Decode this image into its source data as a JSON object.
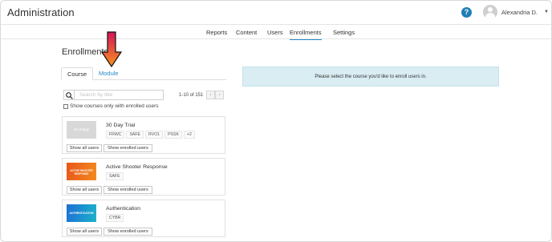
{
  "header": {
    "app_title": "Administration",
    "help_label": "?",
    "user": {
      "name": "Alexandria D.",
      "caret": "▼"
    }
  },
  "nav": {
    "items": [
      {
        "label": "Reports",
        "active": false
      },
      {
        "label": "Content",
        "active": false
      },
      {
        "label": "Users",
        "active": false
      },
      {
        "label": "Enrollments",
        "active": true
      },
      {
        "label": "Settings",
        "active": false
      }
    ]
  },
  "page": {
    "title": "Enrollments"
  },
  "tabs": [
    {
      "label": "Course",
      "active": true
    },
    {
      "label": "Module",
      "active": false
    }
  ],
  "search": {
    "placeholder": "Search by title",
    "value": ""
  },
  "pager": {
    "text": "1-10 of 151",
    "prev": "‹",
    "next": "›"
  },
  "filter": {
    "label": "Show courses only with enrolled users",
    "checked": false
  },
  "courses": [
    {
      "name": "30 Day Trial",
      "thumb": "No Image",
      "tags": [
        "FRWC",
        "SAFE",
        "RVO1",
        "PSSK",
        "+2"
      ]
    },
    {
      "name": "Active Shooter Response",
      "thumb": "ACTIVE SHOOTER RESPONSE",
      "tags": [
        "SAFE"
      ]
    },
    {
      "name": "Authentication",
      "thumb": "AUTHENTICATION",
      "tags": [
        "CYBR"
      ]
    }
  ],
  "buttons": {
    "show_all": "Show all users",
    "show_enrolled": "Show enrolled users"
  },
  "info": {
    "message": "Please select the course you'd like to enroll users in."
  },
  "colors": {
    "accent": "#2a8ac4",
    "info_bg": "#d9edf3",
    "arrow_top": "#d4145a",
    "arrow_bottom": "#f7931e"
  }
}
